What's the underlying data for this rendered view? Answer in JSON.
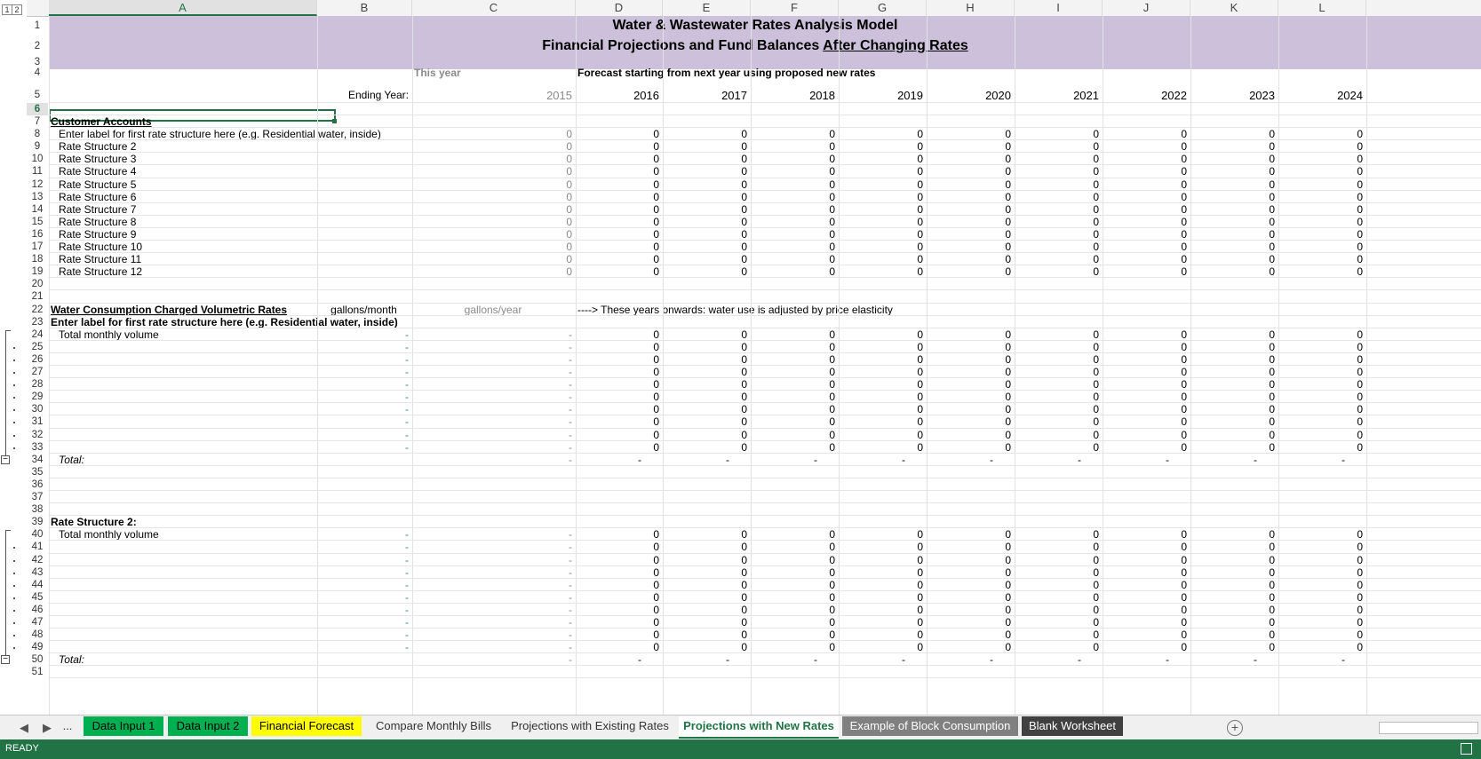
{
  "outline_levels": [
    "1",
    "2"
  ],
  "columns": [
    "A",
    "B",
    "C",
    "D",
    "E",
    "F",
    "G",
    "H",
    "I",
    "J",
    "K",
    "L"
  ],
  "title_line1": "Water & Wastewater Rates Analysis Model",
  "title_line2_prefix": "Financial Projections and Fund Balances ",
  "title_line2_underlined": "After Changing Rates",
  "this_year_label": "This year",
  "forecast_label": "Forecast starting from next year using proposed new rates",
  "ending_year_label": "Ending Year:",
  "years": [
    "2015",
    "2016",
    "2017",
    "2018",
    "2019",
    "2020",
    "2021",
    "2022",
    "2023",
    "2024"
  ],
  "customer_accounts": {
    "heading": "Customer Accounts",
    "rows": [
      "Enter label for first rate structure here (e.g. Residential water, inside)",
      "Rate Structure 2",
      "Rate Structure 3",
      "Rate Structure 4",
      "Rate Structure 5",
      "Rate Structure 6",
      "Rate Structure 7",
      "Rate Structure 8",
      "Rate Structure 9",
      "Rate Structure 10",
      "Rate Structure 11",
      "Rate Structure 12"
    ],
    "value": "0"
  },
  "consumption": {
    "heading": "Water Consumption Charged Volumetric Rates",
    "unit_month": "gallons/month",
    "unit_year": "gallons/year",
    "elasticity_note": "----> These years onwards: water use is adjusted by price elasticity",
    "rate1_label": "Enter label for first rate structure here (e.g. Residential water, inside)",
    "rate2_label": "Rate Structure 2:",
    "volume_label": "Total monthly volume",
    "total_label": "Total:",
    "dash": "-",
    "zero": "0"
  },
  "sheet_tabs": [
    {
      "label": "...",
      "bg": "",
      "color": "#333"
    },
    {
      "label": "Data Input 1",
      "bg": "#00b050",
      "color": "#000"
    },
    {
      "label": "Data Input 2",
      "bg": "#00b050",
      "color": "#000"
    },
    {
      "label": "Financial Forecast",
      "bg": "#ffff00",
      "color": "#000"
    },
    {
      "label": "Compare Monthly Bills",
      "bg": "",
      "color": "#333"
    },
    {
      "label": "Projections with Existing Rates",
      "bg": "",
      "color": "#333"
    },
    {
      "label": "Projections with New Rates",
      "bg": "#ffffff",
      "color": "#217346",
      "active": true
    },
    {
      "label": "Example of Block Consumption",
      "bg": "#808080",
      "color": "#fff"
    },
    {
      "label": "Blank Worksheet",
      "bg": "#404040",
      "color": "#fff"
    }
  ],
  "status": "READY",
  "colors": {
    "accent": "#217346",
    "banner": "#ccc0da"
  }
}
